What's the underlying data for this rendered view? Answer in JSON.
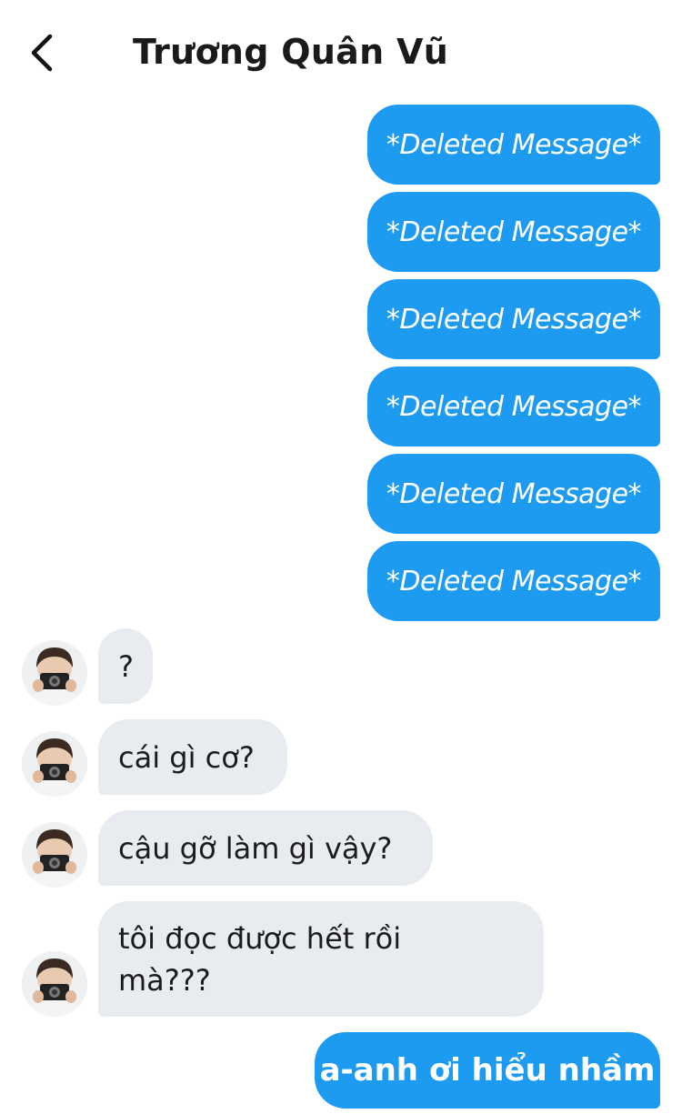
{
  "header": {
    "title": "Trương Quân Vũ",
    "back_icon": "chevron-left-icon"
  },
  "colors": {
    "outgoing_bubble": "#1d9bf0",
    "incoming_bubble": "#e8ebef",
    "title_text": "#1a1a1a"
  },
  "messages": [
    {
      "direction": "outgoing",
      "text": "*Deleted Message*"
    },
    {
      "direction": "outgoing",
      "text": "*Deleted Message*"
    },
    {
      "direction": "outgoing",
      "text": "*Deleted Message*"
    },
    {
      "direction": "outgoing",
      "text": "*Deleted Message*"
    },
    {
      "direction": "outgoing",
      "text": "*Deleted Message*"
    },
    {
      "direction": "outgoing",
      "text": "*Deleted Message*"
    },
    {
      "direction": "incoming",
      "text": "?"
    },
    {
      "direction": "incoming",
      "text": "cái gì cơ?"
    },
    {
      "direction": "incoming",
      "text": "cậu gỡ làm gì vậy?"
    },
    {
      "direction": "incoming",
      "text": "tôi đọc được hết rồi\nmà???"
    },
    {
      "direction": "outgoing",
      "text": "a-anh ơi hiểu nhầm"
    }
  ]
}
